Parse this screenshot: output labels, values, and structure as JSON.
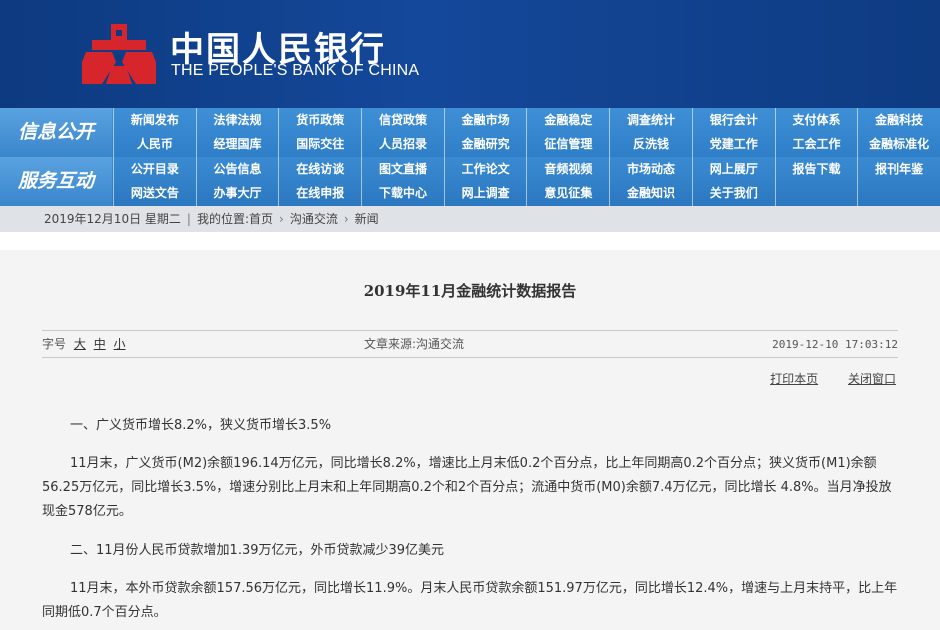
{
  "header": {
    "title_cn": "中国人民银行",
    "title_en": "THE PEOPLE'S BANK OF CHINA",
    "brand_color": "#1a4f9c",
    "emblem_color": "#d7262b"
  },
  "nav": {
    "row1_label": "信息公开",
    "row2_label": "服务互动",
    "row1_items": [
      "新闻发布",
      "法律法规",
      "货币政策",
      "信贷政策",
      "金融市场",
      "金融稳定",
      "调查统计",
      "银行会计",
      "支付体系",
      "金融科技",
      "人民币",
      "经理国库",
      "国际交往",
      "人员招录",
      "金融研究",
      "征信管理",
      "反洗钱",
      "党建工作",
      "工会工作",
      "金融标准化"
    ],
    "row2_items": [
      "公开目录",
      "公告信息",
      "在线访谈",
      "图文直播",
      "工作论文",
      "音频视频",
      "市场动态",
      "网上展厅",
      "报告下载",
      "报刊年鉴",
      "网送文告",
      "办事大厅",
      "在线申报",
      "下载中心",
      "网上调查",
      "意见征集",
      "金融知识",
      "关于我们",
      "",
      ""
    ]
  },
  "breadcrumb": {
    "date": "2019年12月10日 星期二",
    "location_label": "我的位置:首页",
    "level2": "沟通交流",
    "level3": "新闻"
  },
  "article": {
    "title": "2019年11月金融统计数据报告",
    "font_size_label": "字号",
    "font_sizes": [
      "大",
      "中",
      "小"
    ],
    "source": "文章来源:沟通交流",
    "timestamp": "2019-12-10 17:03:12",
    "print_label": "打印本页",
    "close_label": "关闭窗口",
    "paragraphs": [
      "一、广义货币增长8.2%，狭义货币增长3.5%",
      "11月末，广义货币(M2)余额196.14万亿元，同比增长8.2%，增速比上月末低0.2个百分点，比上年同期高0.2个百分点；狭义货币(M1)余额56.25万亿元，同比增长3.5%，增速分别比上月末和上年同期高0.2个和2个百分点；流通中货币(M0)余额7.4万亿元，同比增长 4.8%。当月净投放现金578亿元。",
      "二、11月份人民币贷款增加1.39万亿元，外币贷款减少39亿美元",
      "11月末，本外币贷款余额157.56万亿元，同比增长11.9%。月末人民币贷款余额151.97万亿元，同比增长12.4%，增速与上月末持平，比上年同期低0.7个百分点。"
    ]
  }
}
